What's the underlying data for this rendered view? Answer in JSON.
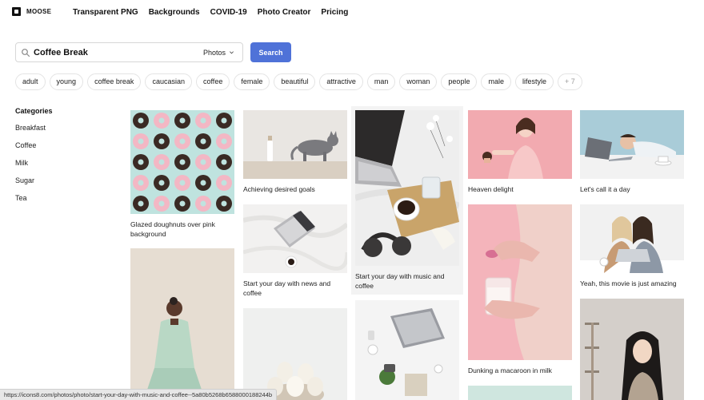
{
  "brand": {
    "name": "MOOSE"
  },
  "nav": {
    "items": [
      "Transparent PNG",
      "Backgrounds",
      "COVID-19",
      "Photo Creator",
      "Pricing"
    ]
  },
  "search": {
    "value": "Coffee Break",
    "type": "Photos",
    "button_label": "Search"
  },
  "tags": [
    "adult",
    "young",
    "coffee break",
    "caucasian",
    "coffee",
    "female",
    "beautiful",
    "attractive",
    "man",
    "woman",
    "people",
    "male",
    "lifestyle",
    "+ 7"
  ],
  "categories": {
    "title": "Categories",
    "items": [
      "Breakfast",
      "Coffee",
      "Milk",
      "Sugar",
      "Tea"
    ]
  },
  "photos": [
    {
      "caption": "Glazed doughnuts over pink background",
      "palette": [
        "#bfe3df",
        "#f3b7c4",
        "#3a2a24"
      ]
    },
    {
      "caption": "",
      "palette": [
        "#e6ddd2",
        "#b9d8c5",
        "#2c2320"
      ]
    },
    {
      "caption": "Achieving desired goals",
      "palette": [
        "#e9e6e2",
        "#7a7a7e",
        "#d9cfc2"
      ]
    },
    {
      "caption": "Start your day with news and coffee",
      "palette": [
        "#f2f1f0",
        "#b9b9bc",
        "#2a1c16"
      ]
    },
    {
      "caption": "",
      "palette": [
        "#eff0ef",
        "#f3efe6",
        "#d1c6b6"
      ]
    },
    {
      "caption": "Start your day with music and coffee",
      "palette": [
        "#eeeeee",
        "#c9a46a",
        "#2c2a2a"
      ]
    },
    {
      "caption": "",
      "palette": [
        "#f4f4f4",
        "#9a9ca2",
        "#4b7a3a"
      ]
    },
    {
      "caption": "Heaven delight",
      "palette": [
        "#f2aab0",
        "#f5d3c6",
        "#4a2c20"
      ]
    },
    {
      "caption": "Dunking a macaroon in milk",
      "palette": [
        "#f4b4bb",
        "#f0d0c9",
        "#d76f93"
      ]
    },
    {
      "caption": "",
      "palette": [
        "#cfe6df",
        "#ffffff",
        "#cccccc"
      ]
    },
    {
      "caption": "Let's call it a day",
      "palette": [
        "#a9ccd8",
        "#f2f2f2",
        "#6b6f76"
      ]
    },
    {
      "caption": "Yeah, this movie is just amazing",
      "palette": [
        "#f1f1f1",
        "#c79b74",
        "#8d98a6"
      ]
    },
    {
      "caption": "",
      "palette": [
        "#d4cfca",
        "#1d1a19",
        "#b3a391"
      ]
    }
  ],
  "status": {
    "url": "https://icons8.com/photos/photo/start-your-day-with-music-and-coffee--5a80b5268b6588000188244b"
  }
}
